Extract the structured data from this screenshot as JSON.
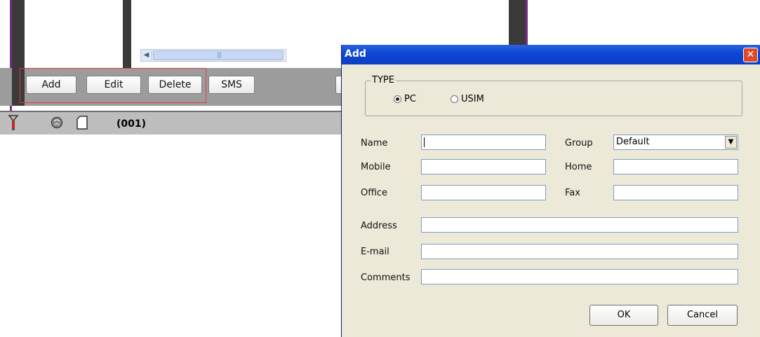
{
  "background_app": {
    "buttons": [
      {
        "label": "Add"
      },
      {
        "label": "Edit"
      },
      {
        "label": "Delete"
      },
      {
        "label": "SMS"
      }
    ],
    "status_text": "(001)",
    "status_icons": [
      "antenna-signal-icon",
      "globe-icon",
      "sim-card-icon"
    ],
    "highlight_color": "#e23c3c"
  },
  "dialog": {
    "title": "Add",
    "close_glyph": "✕",
    "type_group": {
      "legend": "TYPE",
      "options": [
        {
          "label": "PC",
          "selected": true
        },
        {
          "label": "USIM",
          "selected": false
        }
      ]
    },
    "fields": {
      "name": {
        "label": "Name",
        "value": ""
      },
      "group": {
        "label": "Group",
        "value": "Default"
      },
      "mobile": {
        "label": "Mobile",
        "value": ""
      },
      "home": {
        "label": "Home",
        "value": ""
      },
      "office": {
        "label": "Office",
        "value": ""
      },
      "fax": {
        "label": "Fax",
        "value": ""
      },
      "address": {
        "label": "Address",
        "value": ""
      },
      "email": {
        "label": "E-mail",
        "value": ""
      },
      "comments": {
        "label": "Comments",
        "value": ""
      }
    },
    "ok_label": "OK",
    "cancel_label": "Cancel",
    "titlebar_color": "#0e47d4"
  }
}
